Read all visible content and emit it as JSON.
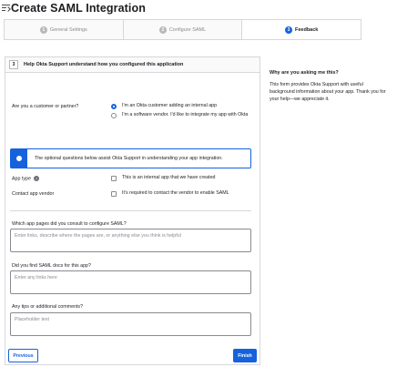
{
  "header": {
    "title": "Create SAML Integration",
    "icon": "app-add-icon"
  },
  "steps": [
    {
      "num": "1",
      "label": "General Settings"
    },
    {
      "num": "2",
      "label": "Configure SAML"
    },
    {
      "num": "3",
      "label": "Feedback"
    }
  ],
  "panel": {
    "num": "3",
    "title": "Help Okta Support understand how you configured this application",
    "customer_question": "Are you a customer or partner?",
    "customer_options": [
      "I'm an Okta customer adding an internal app",
      "I'm a software vendor. I'd like to integrate my app with Okta"
    ],
    "info_text": "The optional questions below assist Okta Support in understanding your app integration.",
    "app_type_label": "App type",
    "app_type_help": "?",
    "app_type_option": "This is an internal app that we have created",
    "contact_label": "Contact app vendor",
    "contact_option": "It's required to contact the vendor to enable SAML",
    "q1_label": "Which app pages did you consult to configure SAML?",
    "q1_placeholder": "Enter links, describe where the pages are, or anything else you think is helpful",
    "q2_label": "Did you find SAML docs for this app?",
    "q2_placeholder": "Enter any links here",
    "q3_label": "Any tips or additional comments?",
    "q3_placeholder": "Placeholder text",
    "prev_label": "Previous",
    "finish_label": "Finish"
  },
  "sidebar": {
    "title": "Why are you asking me this?",
    "body": "This form provides Okta Support with useful background information about your app. Thank you for your help—we appreciate it."
  },
  "colors": {
    "accent": "#1662dd",
    "border": "#d7d7dc",
    "muted": "#8a8a91"
  }
}
